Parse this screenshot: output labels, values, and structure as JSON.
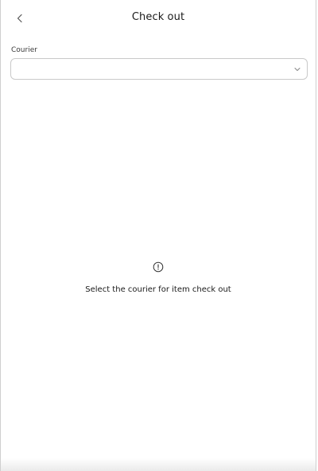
{
  "header": {
    "title": "Check out",
    "back_icon": "chevron-left-icon"
  },
  "courier_field": {
    "label": "Courier",
    "value": "",
    "dropdown_icon": "chevron-down-icon"
  },
  "empty_state": {
    "icon": "info-circle-icon",
    "message": "Select the courier for item check out"
  },
  "colors": {
    "background": "#ffffff",
    "border": "#c9c9c9",
    "text": "#1a1a1a"
  }
}
